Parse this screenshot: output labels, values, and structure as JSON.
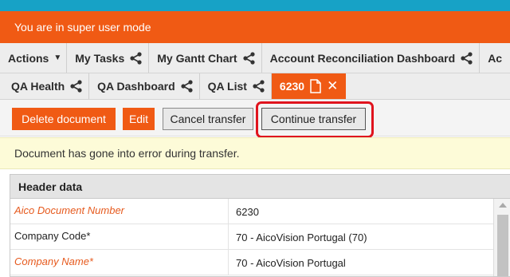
{
  "banner": {
    "text": "You are in super user mode"
  },
  "tabs_row1": [
    {
      "label": "Actions",
      "icon": "caret-down-icon"
    },
    {
      "label": "My Tasks",
      "icon": "share-icon"
    },
    {
      "label": "My Gantt Chart",
      "icon": "share-icon"
    },
    {
      "label": "Account Reconciliation Dashboard",
      "icon": "share-icon"
    },
    {
      "label": "Ac"
    }
  ],
  "tabs_row2": [
    {
      "label": "QA Health",
      "icon": "share-icon"
    },
    {
      "label": "QA Dashboard",
      "icon": "share-icon"
    },
    {
      "label": "QA List",
      "icon": "share-icon"
    },
    {
      "label": "6230",
      "icon": "document-icon",
      "close_icon": "close-icon",
      "active": true
    }
  ],
  "toolbar": {
    "delete_label": "Delete document",
    "edit_label": "Edit",
    "cancel_label": "Cancel transfer",
    "continue_label": "Continue transfer"
  },
  "notice": {
    "text": "Document has gone into error during transfer."
  },
  "header_data": {
    "title": "Header data",
    "rows": [
      {
        "label": "Aico Document Number",
        "value": "6230",
        "style": "required-orange"
      },
      {
        "label": "Company Code*",
        "value": "70 - AicoVision Portugal (70)",
        "style": "normal"
      },
      {
        "label": "Company Name*",
        "value": "70 - AicoVision Portugal",
        "style": "required-orange"
      }
    ]
  },
  "colors": {
    "accent_top": "#17a2c6",
    "brand_orange": "#f05a14",
    "highlight_red": "#e0141e",
    "notice_bg": "#fdfbd8"
  }
}
